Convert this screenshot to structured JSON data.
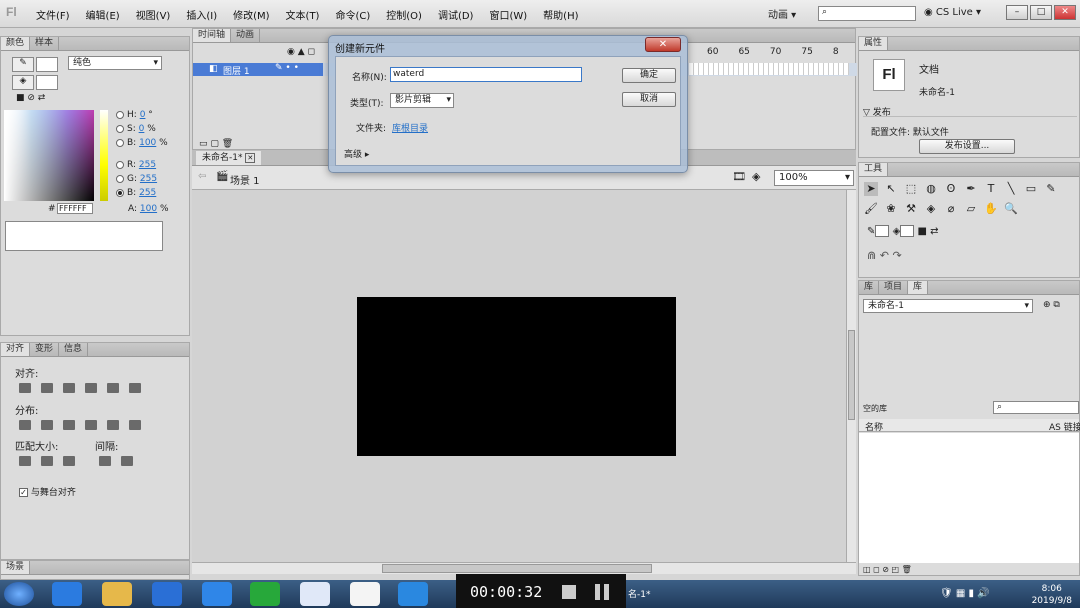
{
  "app": {
    "logo": "Fl",
    "menus": [
      "文件(F)",
      "编辑(E)",
      "视图(V)",
      "插入(I)",
      "修改(M)",
      "文本(T)",
      "命令(C)",
      "控制(O)",
      "调试(D)",
      "窗口(W)",
      "帮助(H)"
    ],
    "mode": "动画 ▾",
    "cslive": "CS Live ▾"
  },
  "color_panel": {
    "tabs": [
      "颜色",
      "样本"
    ],
    "fill_type": "纯色",
    "hsb": [
      {
        "k": "H:",
        "v": "0",
        "u": "°"
      },
      {
        "k": "S:",
        "v": "0",
        "u": "%"
      },
      {
        "k": "B:",
        "v": "100",
        "u": "%"
      }
    ],
    "rgb": [
      {
        "k": "R:",
        "v": "255"
      },
      {
        "k": "G:",
        "v": "255"
      },
      {
        "k": "B:",
        "v": "255"
      }
    ],
    "alpha": {
      "k": "A:",
      "v": "100",
      "u": "%"
    },
    "hex_label": "#",
    "hex": "FFFFFF"
  },
  "align_panel": {
    "tabs": [
      "对齐",
      "变形",
      "信息"
    ],
    "align_label": "对齐:",
    "distribute_label": "分布:",
    "match_label": "匹配大小:",
    "space_label": "间隔:",
    "stage_align": "与舞台对齐"
  },
  "scene_panel": {
    "tab": "场景"
  },
  "timeline": {
    "tabs": [
      "时间轴",
      "动画"
    ],
    "layer": "图层 1",
    "frame_numbers": [
      "60",
      "65",
      "70",
      "75",
      "8"
    ]
  },
  "document": {
    "tab": "未命名-1*",
    "scene": "场景 1",
    "zoom": "100%"
  },
  "properties": {
    "tab": "属性",
    "type": "文档",
    "name": "未命名-1",
    "publish_section": "发布",
    "profile_label": "配置文件:",
    "profile_value": "默认文件",
    "publish_settings": "发布设置..."
  },
  "tools": {
    "tab": "工具"
  },
  "library": {
    "tabs": [
      "库",
      "项目",
      "库"
    ],
    "doc": "未命名-1",
    "empty_label": "空的库",
    "name_col": "名称",
    "linkage_col": "AS 链接"
  },
  "dialog": {
    "title": "创建新元件",
    "name_label": "名称(N):",
    "name_value": "waterd",
    "type_label": "类型(T):",
    "type_value": "影片剪辑",
    "folder_label": "文件夹:",
    "folder_value": "库根目录",
    "advanced": "高级",
    "ok": "确定",
    "cancel": "取消"
  },
  "taskbar": {
    "timer": "00:00:32",
    "window_label": "名-1*",
    "time": "8:06",
    "date": "2019/9/8"
  }
}
